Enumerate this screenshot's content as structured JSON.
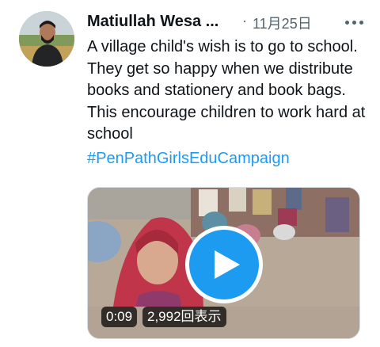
{
  "author": {
    "name": "Matiullah Wesa ...",
    "separator": "·",
    "date": "11月25日"
  },
  "tweet": {
    "text": "A village child's wish is to go to school. They get so happy when we distribute books and stationery and book bags. This encourage children to work hard at school",
    "hashtag": "#PenPathGirlsEduCampaign"
  },
  "video": {
    "duration": "0:09",
    "views": "2,992回表示"
  },
  "icons": {
    "more": "more-options-icon",
    "play": "play-icon"
  },
  "colors": {
    "link": "#1d9bf0",
    "text": "#0f1419",
    "muted": "#536471",
    "play_button": "#1d9bf0"
  }
}
